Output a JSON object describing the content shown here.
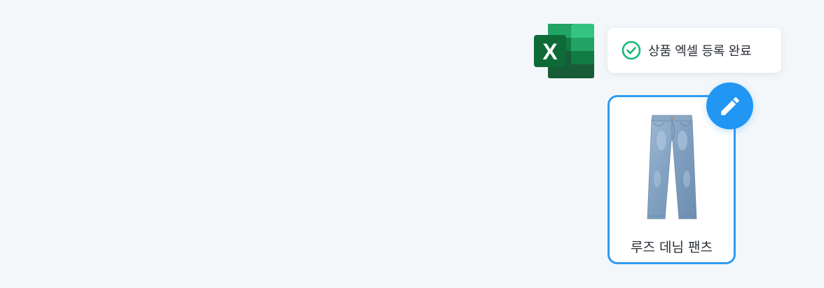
{
  "excel": {
    "icon": "excel-icon",
    "letter": "X",
    "colors": {
      "dark": "#185c37",
      "mid": "#107c41",
      "light": "#21a366",
      "lighter": "#33c481",
      "tile": "#107c41"
    }
  },
  "toast": {
    "icon": "check-circle-icon",
    "message": "상품 엑셀 등록 완료",
    "accent": "#14b87a"
  },
  "product_card": {
    "name": "루즈 데님 팬츠",
    "image": "jeans-image",
    "border_color": "#2f9bf2"
  },
  "edit_button": {
    "icon": "pencil-icon",
    "color": "#2196f3"
  }
}
